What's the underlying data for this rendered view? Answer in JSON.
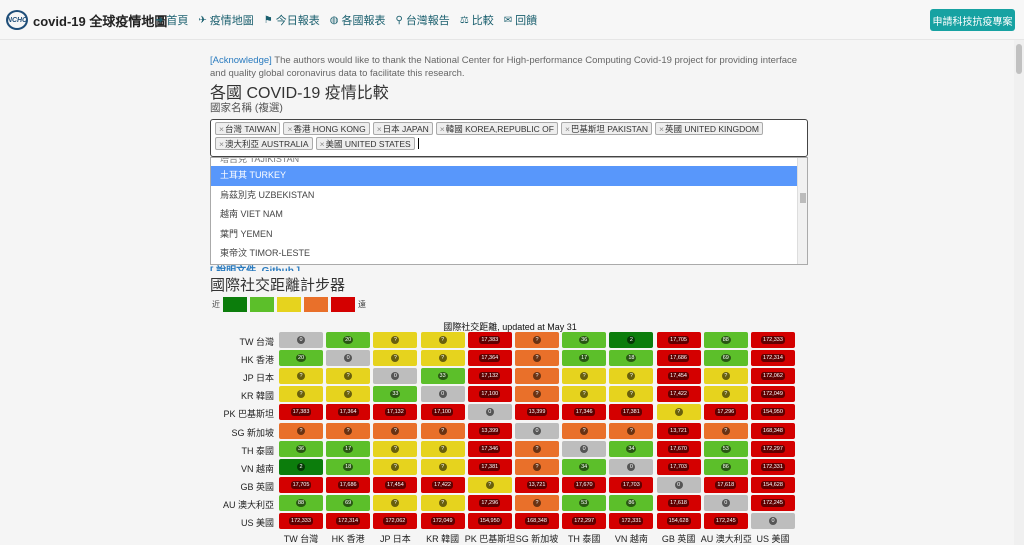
{
  "header": {
    "logo_text": "NCHC",
    "brand": "covid-19 全球疫情地圖",
    "nav": [
      {
        "icon": "arrow-right-icon",
        "glyph": "➜",
        "label": "首頁"
      },
      {
        "icon": "plane-icon",
        "glyph": "✈",
        "label": "疫情地圖"
      },
      {
        "icon": "flag-icon",
        "glyph": "⚑",
        "label": "今日報表"
      },
      {
        "icon": "globe-icon",
        "glyph": "◍",
        "label": "各國報表"
      },
      {
        "icon": "map-marker-icon",
        "glyph": "⚲",
        "label": "台灣報告"
      },
      {
        "icon": "balance-scale-icon",
        "glyph": "⚖",
        "label": "比較"
      },
      {
        "icon": "envelope-icon",
        "glyph": "✉",
        "label": "回饋"
      }
    ],
    "cta": "申請科技抗疫專案"
  },
  "acknowledge": {
    "tag": "[Acknowledge]",
    "text": " The authors would like to thank the National Center for High-performance Computing Covid-19 project for providing interface and quality global coronavirus data to facilitate this research."
  },
  "title": "各國 COVID-19 疫情比較",
  "country_label": "國家名稱 (複選)",
  "selected": [
    "台灣 TAIWAN",
    "香港 HONG KONG",
    "日本 JAPAN",
    "韓國 KOREA,REPUBLIC OF",
    "巴基斯坦 PAKISTAN",
    "英國 UNITED KINGDOM",
    "澳大利亞 AUSTRALIA",
    "美國 UNITED STATES"
  ],
  "dropdown": {
    "options": [
      "塔吉克 TAJIKISTAN",
      "土耳其 TURKEY",
      "烏茲別克 UZBEKISTAN",
      "越南 VIET NAM",
      "葉門 YEMEN",
      "東帝汶 TIMOR-LESTE"
    ],
    "highlighted": 1
  },
  "doc_link": "[ 說明文件, Github ]",
  "distance_title": "國際社交距離計步器",
  "legend": {
    "near": "近",
    "far": "遠",
    "colors": [
      "#0c7d0c",
      "#5cbf2a",
      "#e6d31e",
      "#e9702a",
      "#d40000"
    ]
  },
  "chart_data": {
    "type": "heatmap",
    "title": "國際社交距離, updated at May 31",
    "rows": [
      "TW 台灣",
      "HK 香港",
      "JP 日本",
      "KR 韓國",
      "PK 巴基斯坦",
      "SG 新加坡",
      "TH 泰國",
      "VN 越南",
      "GB 英國",
      "AU 澳大利亞",
      "US 美國"
    ],
    "columns": [
      "TW 台灣",
      "HK 香港",
      "JP 日本",
      "KR 韓國",
      "PK 巴基斯坦",
      "SG 新加坡",
      "TH 泰國",
      "VN 越南",
      "GB 英國",
      "AU 澳大利亞",
      "US 美國"
    ],
    "values": [
      [
        "0",
        "20",
        "?",
        "?",
        "17,383",
        "?",
        "36",
        "2",
        "17,705",
        "88",
        "172,333"
      ],
      [
        "20",
        "0",
        "?",
        "?",
        "17,364",
        "?",
        "17",
        "18",
        "17,686",
        "69",
        "172,314"
      ],
      [
        "?",
        "?",
        "0",
        "33",
        "17,132",
        "?",
        "?",
        "?",
        "17,454",
        "?",
        "172,062"
      ],
      [
        "?",
        "?",
        "33",
        "0",
        "17,100",
        "?",
        "?",
        "?",
        "17,422",
        "?",
        "172,049"
      ],
      [
        "17,383",
        "17,364",
        "17,132",
        "17,100",
        "0",
        "13,399",
        "17,346",
        "17,381",
        "?",
        "17,296",
        "154,950"
      ],
      [
        "?",
        "?",
        "?",
        "?",
        "13,399",
        "0",
        "?",
        "?",
        "13,721",
        "?",
        "168,348"
      ],
      [
        "36",
        "17",
        "?",
        "?",
        "17,346",
        "?",
        "0",
        "34",
        "17,670",
        "53",
        "172,297"
      ],
      [
        "2",
        "18",
        "?",
        "?",
        "17,381",
        "?",
        "34",
        "0",
        "17,703",
        "86",
        "172,331"
      ],
      [
        "17,705",
        "17,686",
        "17,454",
        "17,422",
        "?",
        "13,721",
        "17,670",
        "17,703",
        "0",
        "17,618",
        "154,628"
      ],
      [
        "88",
        "69",
        "?",
        "?",
        "17,296",
        "?",
        "53",
        "86",
        "17,618",
        "0",
        "172,245"
      ],
      [
        "172,333",
        "172,314",
        "172,062",
        "172,049",
        "154,950",
        "168,348",
        "172,297",
        "172,331",
        "154,628",
        "172,245",
        "0"
      ]
    ],
    "colors": [
      [
        "#bdbdbd",
        "#5cbf2a",
        "#e6d31e",
        "#e6d31e",
        "#d40000",
        "#e9702a",
        "#5cbf2a",
        "#0c7d0c",
        "#d40000",
        "#5cbf2a",
        "#d40000"
      ],
      [
        "#5cbf2a",
        "#bdbdbd",
        "#e6d31e",
        "#e6d31e",
        "#d40000",
        "#e9702a",
        "#5cbf2a",
        "#5cbf2a",
        "#d40000",
        "#5cbf2a",
        "#d40000"
      ],
      [
        "#e6d31e",
        "#e6d31e",
        "#bdbdbd",
        "#5cbf2a",
        "#d40000",
        "#e9702a",
        "#e6d31e",
        "#e6d31e",
        "#d40000",
        "#e6d31e",
        "#d40000"
      ],
      [
        "#e6d31e",
        "#e6d31e",
        "#5cbf2a",
        "#bdbdbd",
        "#d40000",
        "#e9702a",
        "#e6d31e",
        "#e6d31e",
        "#d40000",
        "#e6d31e",
        "#d40000"
      ],
      [
        "#d40000",
        "#d40000",
        "#d40000",
        "#d40000",
        "#bdbdbd",
        "#d40000",
        "#d40000",
        "#d40000",
        "#e6d31e",
        "#d40000",
        "#d40000"
      ],
      [
        "#e9702a",
        "#e9702a",
        "#e9702a",
        "#e9702a",
        "#d40000",
        "#bdbdbd",
        "#e9702a",
        "#e9702a",
        "#d40000",
        "#e9702a",
        "#d40000"
      ],
      [
        "#5cbf2a",
        "#5cbf2a",
        "#e6d31e",
        "#e6d31e",
        "#d40000",
        "#e9702a",
        "#bdbdbd",
        "#5cbf2a",
        "#d40000",
        "#5cbf2a",
        "#d40000"
      ],
      [
        "#0c7d0c",
        "#5cbf2a",
        "#e6d31e",
        "#e6d31e",
        "#d40000",
        "#e9702a",
        "#5cbf2a",
        "#bdbdbd",
        "#d40000",
        "#5cbf2a",
        "#d40000"
      ],
      [
        "#d40000",
        "#d40000",
        "#d40000",
        "#d40000",
        "#e6d31e",
        "#d40000",
        "#d40000",
        "#d40000",
        "#bdbdbd",
        "#d40000",
        "#d40000"
      ],
      [
        "#5cbf2a",
        "#5cbf2a",
        "#e6d31e",
        "#e6d31e",
        "#d40000",
        "#e9702a",
        "#5cbf2a",
        "#5cbf2a",
        "#d40000",
        "#bdbdbd",
        "#d40000"
      ],
      [
        "#d40000",
        "#d40000",
        "#d40000",
        "#d40000",
        "#d40000",
        "#d40000",
        "#d40000",
        "#d40000",
        "#d40000",
        "#d40000",
        "#bdbdbd"
      ]
    ]
  }
}
